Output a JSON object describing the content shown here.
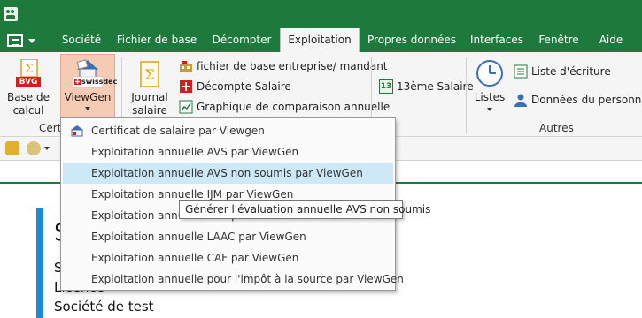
{
  "menu": {
    "tabs": [
      "Société",
      "Fichier de base",
      "Décompter",
      "Exploitation",
      "Propres données",
      "Interfaces",
      "Fenêtre",
      "Aide"
    ],
    "active_tab": "Exploitation"
  },
  "ribbon": {
    "base_de_calcul": {
      "line1": "Base de",
      "line2": "calcul",
      "badge": "BVG"
    },
    "viewgen": {
      "label": "ViewGen",
      "brand": "swissdec"
    },
    "journal": {
      "line1": "Journal",
      "line2": "salaire"
    },
    "small_buttons": [
      "fichier de base entreprise/ mandant",
      "Décompte Salaire",
      "Graphique de comparaison annuelle"
    ],
    "treizieme": {
      "label": "13ème Salaire",
      "icon_text": "13"
    },
    "listes": {
      "label": "Listes"
    },
    "autres_buttons": [
      "Liste d'écriture",
      "Données du personnel"
    ],
    "group_labels": {
      "certif": "Certi",
      "autres": "Autres"
    }
  },
  "dropdown": {
    "items": [
      "Certificat de salaire par Viewgen",
      "Exploitation annuelle AVS par ViewGen",
      "Exploitation annuelle AVS non soumis par ViewGen",
      "Exploitation annuelle IJM par ViewGen",
      "Exploitation annuelle LAA par ViewGen",
      "Exploitation annuelle LAAC par ViewGen",
      "Exploitation annuelle CAF par ViewGen",
      "Exploitation annuelle pour l'impôt à la source par ViewGen"
    ],
    "highlighted_index": 2
  },
  "tooltip": {
    "text": "Générer l'évaluation annuelle AVS non soumis"
  },
  "content": {
    "lines": [
      "S",
      "S",
      "Licence",
      "Société de test"
    ]
  },
  "colors": {
    "brand_green": "#1e7a3c",
    "accent_blue": "#1c8ad6",
    "highlight": "#cde8f6",
    "selected_button": "#f6cbb4"
  }
}
